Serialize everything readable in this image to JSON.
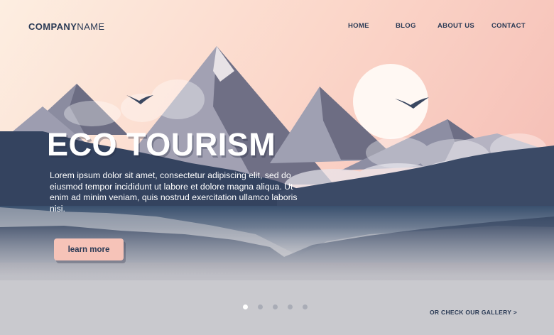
{
  "brand": {
    "bold": "COMPANY",
    "regular": "NAME"
  },
  "nav": {
    "items": [
      {
        "label": "HOME"
      },
      {
        "label": "BLOG"
      },
      {
        "label": "ABOUT US"
      },
      {
        "label": "CONTACT"
      }
    ]
  },
  "hero": {
    "title": "ECO TOURISM",
    "body": "Lorem ipsum dolor sit amet, consectetur adipiscing elit, sed do eiusmod tempor incididunt ut labore et dolore magna aliqua. Ut enim ad minim veniam, quis nostrud exercitation ullamco laboris nisi.",
    "cta_label": "learn more"
  },
  "carousel": {
    "count": 5,
    "active": 1
  },
  "gallery_link": "OR CHECK OUR GALLERY >",
  "colors": {
    "sky_top": "#fde9dc",
    "sky_pink": "#f8c7bd",
    "mountain": "#6f6f86",
    "navy": "#2a3a55",
    "button": "#f6c3b8",
    "mist": "#c9c9ce"
  }
}
